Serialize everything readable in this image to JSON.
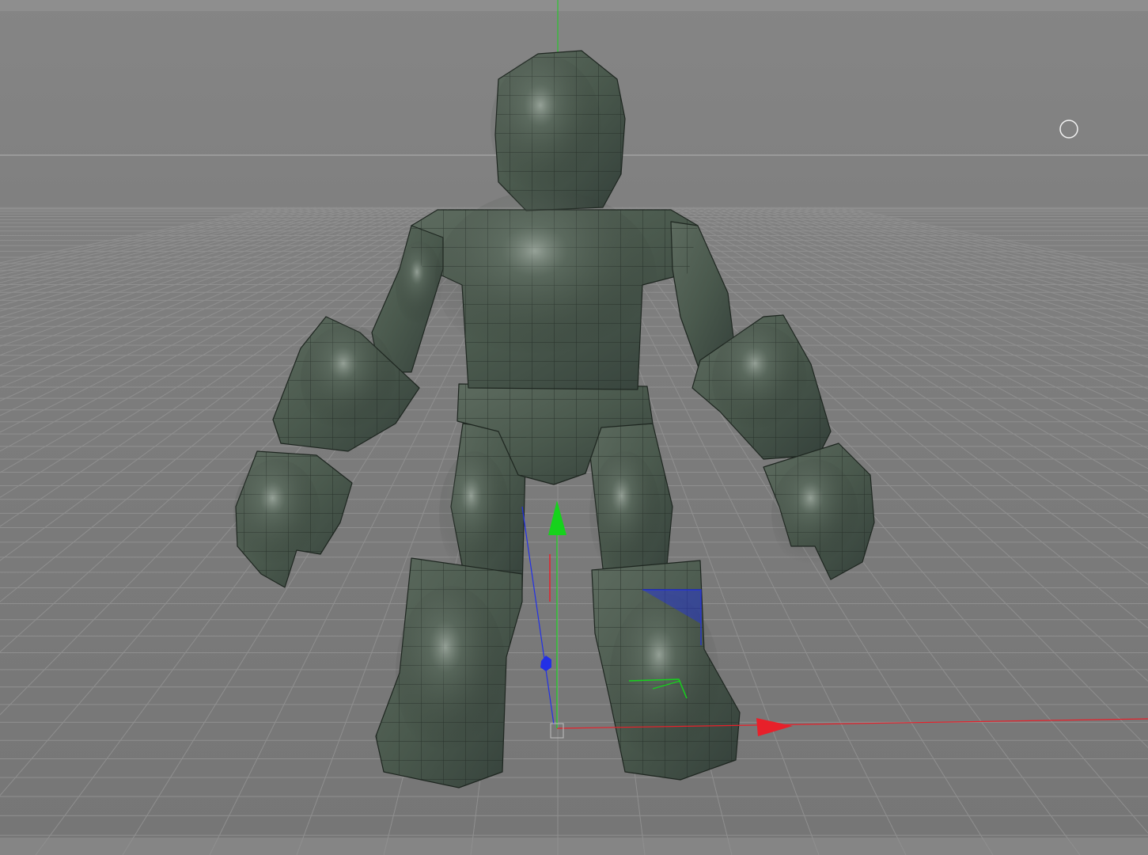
{
  "app": {
    "view": "perspective-viewport",
    "colors": {
      "background": "#7b7b7b",
      "grid": "#8f8f8f",
      "horizon": "#a9a9a9",
      "mesh_fill": "#4b5a4e",
      "mesh_wire": "#1e2620",
      "axis_x": "#e8202a",
      "axis_y": "#16d21c",
      "axis_z": "#2230e6"
    }
  },
  "viewport": {
    "icons": {
      "navigation": "orbit-circle-icon",
      "gizmo": "move-gizmo-icon",
      "origin": "origin-handle-icon"
    },
    "object": {
      "name": "robot-mesh",
      "display": "gouraud-shading-wireframe"
    }
  }
}
